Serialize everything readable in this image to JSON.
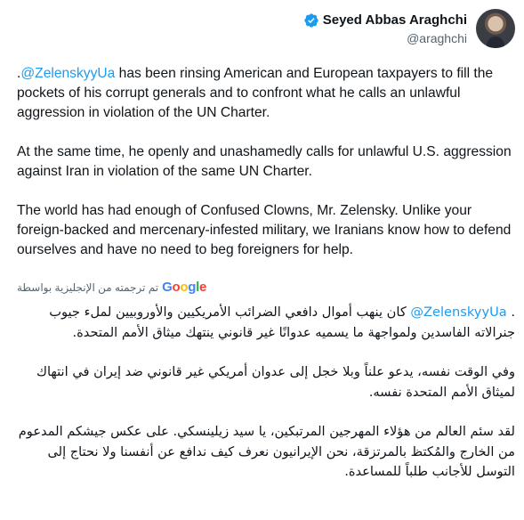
{
  "author": {
    "display_name": "Seyed Abbas Araghchi",
    "handle": "@araghchi",
    "verified_icon": "verified-badge-icon",
    "verified_color": "#1d9bf0"
  },
  "tweet_en": {
    "p1_prefix": ".",
    "p1_mention": "@ZelenskyyUa",
    "p1_rest": " has been rinsing American and European taxpayers to fill the pockets of his corrupt generals and to confront what he calls an unlawful aggression in violation of the UN Charter.",
    "p2": "At the same time, he openly and unashamedly calls for unlawful U.S. aggression against Iran in violation of the same UN Charter.",
    "p3": "The world has had enough of Confused Clowns, Mr. Zelensky. Unlike your foreign-backed and mercenary-infested military, we Iranians know how to defend ourselves and have no need to beg foreigners for help."
  },
  "translation": {
    "provider": "Google",
    "label": "تم ترجمته من الإنجليزية بواسطة"
  },
  "tweet_ar": {
    "p1_prefix": ". ",
    "p1_mention": "@ZelenskyyUa",
    "p1_rest": " كان ينهب أموال دافعي الضرائب الأمريكيين والأوروبيين لملء جيوب جنرالاته الفاسدين ولمواجهة ما يسميه عدوانًا غير قانوني ينتهك ميثاق الأمم المتحدة.",
    "p2": "وفي الوقت نفسه، يدعو علناً وبلا خجل إلى عدوان أمريكي غير قانوني ضد إيران في انتهاك لميثاق الأمم المتحدة نفسه.",
    "p3": "لقد سئم العالم من هؤلاء المهرجين المرتبكين، يا سيد زيلينسكي. على عكس جيشكم المدعوم من الخارج والمُكتظ بالمرتزقة، نحن الإيرانيون نعرف كيف ندافع عن أنفسنا ولا نحتاج إلى التوسل للأجانب طلباً للمساعدة."
  },
  "colors": {
    "link": "#1d9bf0",
    "text": "#0f1419",
    "secondary": "#536471"
  }
}
